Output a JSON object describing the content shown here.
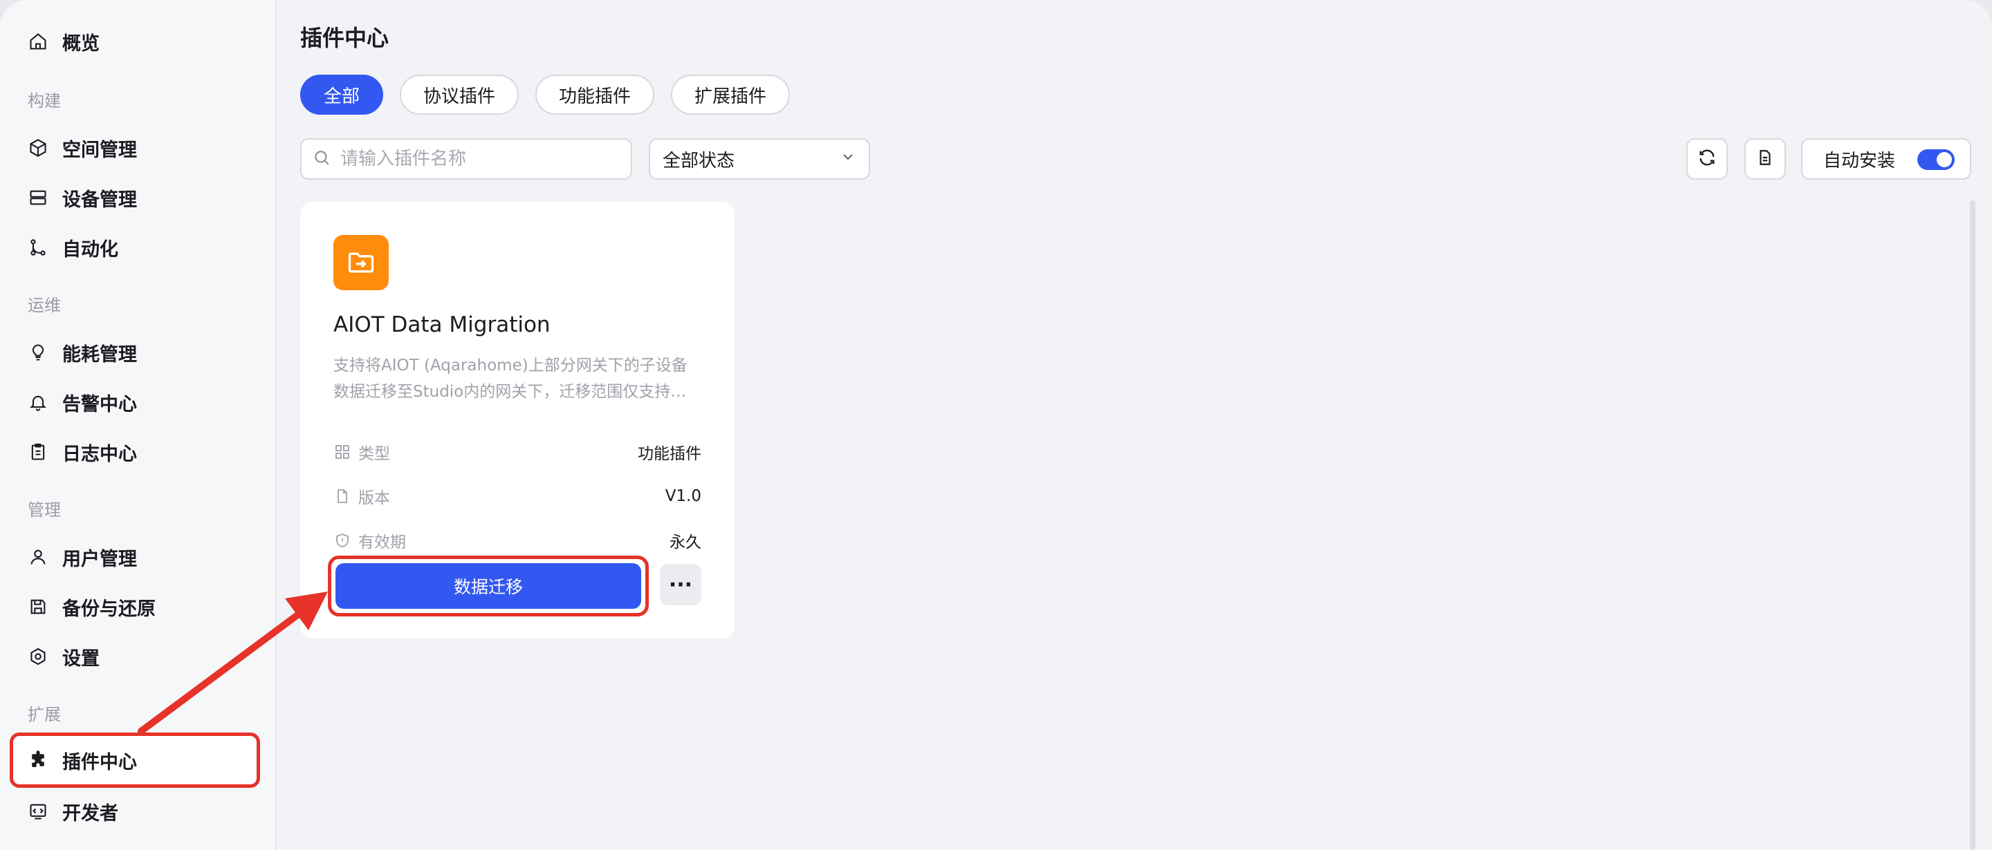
{
  "sidebar": {
    "overview": "概览",
    "groups": {
      "build": "构建",
      "ops": "运维",
      "manage": "管理",
      "extend": "扩展"
    },
    "items": {
      "space": "空间管理",
      "devices": "设备管理",
      "automation": "自动化",
      "energy": "能耗管理",
      "alerts": "告警中心",
      "logs": "日志中心",
      "users": "用户管理",
      "backup": "备份与还原",
      "settings": "设置",
      "plugins": "插件中心",
      "developer": "开发者"
    }
  },
  "main": {
    "title": "插件中心",
    "tabs": [
      "全部",
      "协议插件",
      "功能插件",
      "扩展插件"
    ],
    "search_placeholder": "请输入插件名称",
    "status_select": "全部状态",
    "auto_install_label": "自动安装",
    "auto_install_on": true
  },
  "card": {
    "title": "AIOT Data Migration",
    "desc_line1": "支持将AIOT (Aqarahome)上部分网关下的子设备",
    "desc_line2": "数据迁移至Studio内的网关下，迁移范围仅支持…",
    "type_label": "类型",
    "type_value": "功能插件",
    "version_label": "版本",
    "version_value": "V1.0",
    "validity_label": "有效期",
    "validity_value": "永久",
    "action_label": "数据迁移",
    "more_label": "···"
  },
  "colors": {
    "accent": "#3358f2",
    "plugin_icon_bg": "#ff8c0a",
    "annotation_red": "#e63228"
  }
}
